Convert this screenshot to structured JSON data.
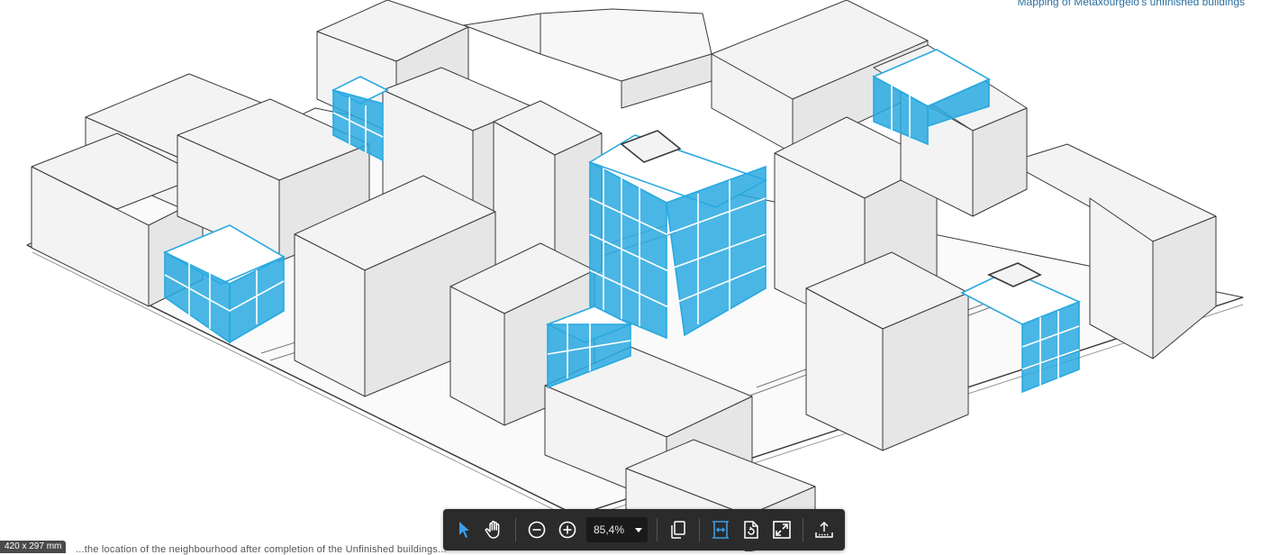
{
  "document": {
    "caption": "Mapping of Metaxourgeio's unfinished buildings",
    "bottom_text": "...the location of the neighbourhood after completion of the Unfinished buildings...",
    "page_size": "420 x 297 mm"
  },
  "toolbar": {
    "zoom": "85,4%",
    "tools": [
      {
        "name": "select-tool",
        "icon": "arrow-pointer-icon",
        "active": true
      },
      {
        "name": "pan-tool",
        "icon": "hand-icon",
        "active": false
      },
      {
        "name": "zoom-out",
        "icon": "minus-circle-icon",
        "active": false
      },
      {
        "name": "zoom-in",
        "icon": "plus-circle-icon",
        "active": false
      },
      {
        "name": "page-view",
        "icon": "pages-icon",
        "active": false
      },
      {
        "name": "fit-width",
        "icon": "fit-width-icon",
        "active": true
      },
      {
        "name": "rotate",
        "icon": "rotate-page-icon",
        "active": false
      },
      {
        "name": "full-screen",
        "icon": "expand-icon",
        "active": false
      },
      {
        "name": "export",
        "icon": "upload-tray-icon",
        "active": false
      }
    ]
  },
  "colors": {
    "highlight": "#29a9e0",
    "building_face": "#f3f3f3",
    "building_stroke": "#3a3a3a",
    "toolbar_bg": "#2b2b2b",
    "accent_icon": "#3b9ee8"
  }
}
